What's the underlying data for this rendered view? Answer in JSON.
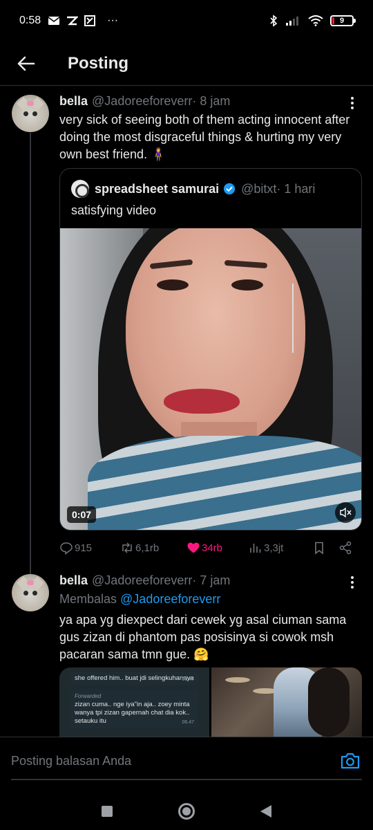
{
  "status_bar": {
    "time": "0:58",
    "left_icons": [
      "mail-icon",
      "app-icon",
      "app-icon-2"
    ],
    "more": "···",
    "battery": "9",
    "battery_level": 0.09,
    "colors": {
      "battery_low": "#f4212e"
    }
  },
  "header": {
    "title": "Posting"
  },
  "post1": {
    "name": "bella",
    "handle": "@Jadoreeforeverr",
    "time": " · 8 jam",
    "text": "very sick of seeing both of them acting innocent after doing the most disgraceful things & hurting my very own best friend. 🧍‍♀️",
    "quote": {
      "name": "spreadsheet samurai",
      "handle": "@bitxt",
      "time": " · 1 hari",
      "text": "satisfying video",
      "video_time": "0:07"
    },
    "actions": {
      "replies": "915",
      "reposts": "6,1rb",
      "likes": "34rb",
      "views": "3,3jt"
    }
  },
  "post2": {
    "name": "bella",
    "handle": "@Jadoreeforeverr",
    "time": " · 7 jam",
    "reply_prefix": "Membalas ",
    "reply_mention": "@Jadoreeforeverr",
    "text": "ya apa yg diexpect dari cewek yg asal ciuman sama gus zizan di phantom pas posisinya si cowok msh pacaran sama tmn gue. 🤗",
    "chat": {
      "msg1": "she offered him.. buat jdi selingkuhannya",
      "msg1_time": "06.47",
      "fwd": "Forwarded",
      "msg2": "zizan cuma.. nge iya\"in aja.. zoey minta wanya tpi zizan gapernah chat dia kok.. setauku itu",
      "msg2_time": "06.47"
    }
  },
  "compose": {
    "placeholder": "Posting balasan Anda"
  },
  "colors": {
    "accent": "#1d9bf0",
    "like": "#f91880",
    "muted": "#71767b",
    "text": "#e7e9ea",
    "background": "#000000"
  }
}
